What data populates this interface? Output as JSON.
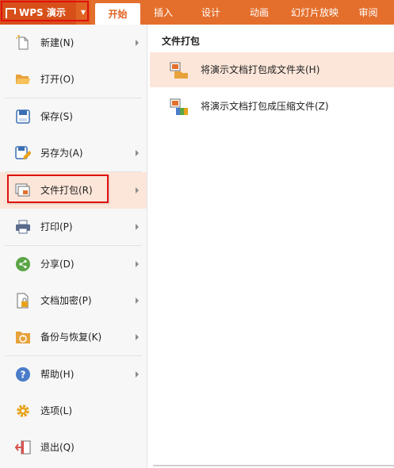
{
  "app": {
    "title": "WPS 演示"
  },
  "ribbon": {
    "tabs": [
      {
        "label": "开始",
        "active": true
      },
      {
        "label": "插入"
      },
      {
        "label": "设计"
      },
      {
        "label": "动画"
      },
      {
        "label": "幻灯片放映"
      },
      {
        "label": "审阅"
      }
    ]
  },
  "menu": {
    "items": [
      {
        "label": "新建(N)",
        "icon": "new-file-icon",
        "has_submenu": true
      },
      {
        "label": "打开(O)",
        "icon": "folder-open-icon",
        "has_submenu": false
      },
      {
        "label": "保存(S)",
        "icon": "save-icon",
        "has_submenu": false
      },
      {
        "label": "另存为(A)",
        "icon": "save-as-icon",
        "has_submenu": true
      },
      {
        "label": "文件打包(R)",
        "icon": "package-icon",
        "has_submenu": true,
        "selected": true
      },
      {
        "label": "打印(P)",
        "icon": "printer-icon",
        "has_submenu": true
      },
      {
        "label": "分享(D)",
        "icon": "share-icon",
        "has_submenu": true
      },
      {
        "label": "文档加密(P)",
        "icon": "encrypt-icon",
        "has_submenu": true
      },
      {
        "label": "备份与恢复(K)",
        "icon": "backup-icon",
        "has_submenu": true
      },
      {
        "label": "帮助(H)",
        "icon": "help-icon",
        "has_submenu": true
      },
      {
        "label": "选项(L)",
        "icon": "gear-icon",
        "has_submenu": false
      },
      {
        "label": "退出(Q)",
        "icon": "exit-icon",
        "has_submenu": false
      }
    ]
  },
  "panel": {
    "title": "文件打包",
    "items": [
      {
        "label": "将演示文档打包成文件夹(H)",
        "icon": "package-folder-icon"
      },
      {
        "label": "将演示文档打包成压缩文件(Z)",
        "icon": "package-zip-icon"
      }
    ]
  },
  "colors": {
    "ribbon": "#e46f2c",
    "accent": "#d7501a",
    "selected_bg": "#fce6d9",
    "highlight_box": "#e01010"
  }
}
